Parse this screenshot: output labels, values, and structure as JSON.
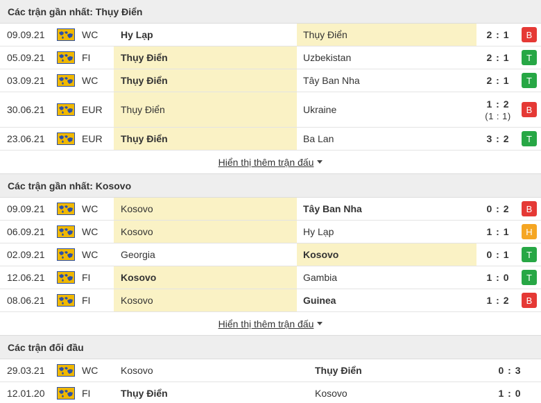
{
  "sections": [
    {
      "title": "Các trận gần nhất: Thụy Điển",
      "more_label": "Hiển thị thêm trận đấu",
      "matches": [
        {
          "date": "09.09.21",
          "comp": "WC",
          "home": "Hy Lạp",
          "away": "Thụy Điển",
          "score": "2 : 1",
          "result": "B"
        },
        {
          "date": "05.09.21",
          "comp": "FI",
          "home": "Thụy Điển",
          "away": "Uzbekistan",
          "score": "2 : 1",
          "result": "T"
        },
        {
          "date": "03.09.21",
          "comp": "WC",
          "home": "Thụy Điển",
          "away": "Tây Ban Nha",
          "score": "2 : 1",
          "result": "T"
        },
        {
          "date": "30.06.21",
          "comp": "EUR",
          "home": "Thụy Điển",
          "away": "Ukraine",
          "score": "1 : 2",
          "score_sub": "(1 : 1)",
          "result": "B"
        },
        {
          "date": "23.06.21",
          "comp": "EUR",
          "home": "Thụy Điển",
          "away": "Ba Lan",
          "score": "3 : 2",
          "result": "T"
        }
      ]
    },
    {
      "title": "Các trận gần nhất: Kosovo",
      "more_label": "Hiển thị thêm trận đấu",
      "matches": [
        {
          "date": "09.09.21",
          "comp": "WC",
          "home": "Kosovo",
          "away": "Tây Ban Nha",
          "score": "0 : 2",
          "result": "B"
        },
        {
          "date": "06.09.21",
          "comp": "WC",
          "home": "Kosovo",
          "away": "Hy Lạp",
          "score": "1 : 1",
          "result": "H"
        },
        {
          "date": "02.09.21",
          "comp": "WC",
          "home": "Georgia",
          "away": "Kosovo",
          "score": "0 : 1",
          "result": "T"
        },
        {
          "date": "12.06.21",
          "comp": "FI",
          "home": "Kosovo",
          "away": "Gambia",
          "score": "1 : 0",
          "result": "T"
        },
        {
          "date": "08.06.21",
          "comp": "FI",
          "home": "Kosovo",
          "away": "Guinea",
          "score": "1 : 2",
          "result": "B"
        }
      ]
    },
    {
      "title": "Các trận đối đầu",
      "matches": [
        {
          "date": "29.03.21",
          "comp": "WC",
          "home": "Kosovo",
          "away": "Thụy Điển",
          "score": "0 : 3"
        },
        {
          "date": "12.01.20",
          "comp": "FI",
          "home": "Thụy Điển",
          "away": "Kosovo",
          "score": "1 : 0"
        }
      ]
    }
  ],
  "icons": {
    "flag": "world-map-flag-icon",
    "more": "caret-down-icon"
  },
  "colors": {
    "loss": "#e53935",
    "win": "#27a745",
    "draw": "#f5a623",
    "highlight": "#faf2c5",
    "header": "#eeeeee"
  }
}
